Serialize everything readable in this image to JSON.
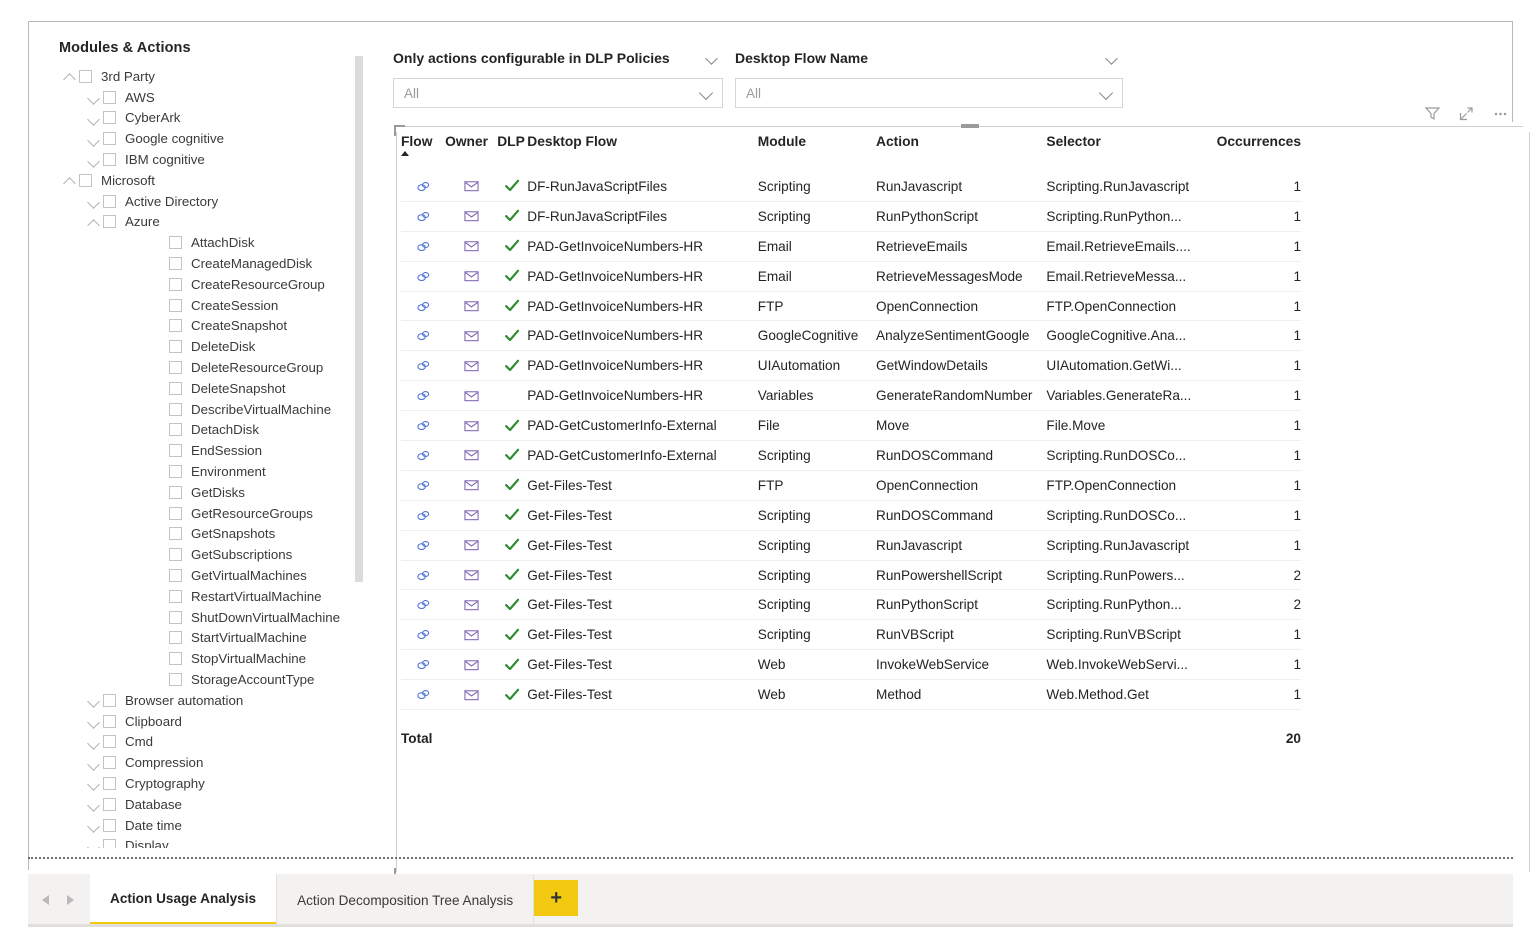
{
  "tree": {
    "title": "Modules & Actions",
    "items": [
      {
        "label": "3rd Party",
        "level": 0,
        "chevron": "up"
      },
      {
        "label": "AWS",
        "level": 1,
        "chevron": "down"
      },
      {
        "label": "CyberArk",
        "level": 1,
        "chevron": "down"
      },
      {
        "label": "Google cognitive",
        "level": 1,
        "chevron": "down"
      },
      {
        "label": "IBM cognitive",
        "level": 1,
        "chevron": "down"
      },
      {
        "label": "Microsoft",
        "level": 0,
        "chevron": "up"
      },
      {
        "label": "Active Directory",
        "level": 1,
        "chevron": "down"
      },
      {
        "label": "Azure",
        "level": 1,
        "chevron": "up"
      },
      {
        "label": "AttachDisk",
        "level": 3,
        "chevron": "none"
      },
      {
        "label": "CreateManagedDisk",
        "level": 3,
        "chevron": "none"
      },
      {
        "label": "CreateResourceGroup",
        "level": 3,
        "chevron": "none"
      },
      {
        "label": "CreateSession",
        "level": 3,
        "chevron": "none"
      },
      {
        "label": "CreateSnapshot",
        "level": 3,
        "chevron": "none"
      },
      {
        "label": "DeleteDisk",
        "level": 3,
        "chevron": "none"
      },
      {
        "label": "DeleteResourceGroup",
        "level": 3,
        "chevron": "none"
      },
      {
        "label": "DeleteSnapshot",
        "level": 3,
        "chevron": "none"
      },
      {
        "label": "DescribeVirtualMachine",
        "level": 3,
        "chevron": "none"
      },
      {
        "label": "DetachDisk",
        "level": 3,
        "chevron": "none"
      },
      {
        "label": "EndSession",
        "level": 3,
        "chevron": "none"
      },
      {
        "label": "Environment",
        "level": 3,
        "chevron": "none"
      },
      {
        "label": "GetDisks",
        "level": 3,
        "chevron": "none"
      },
      {
        "label": "GetResourceGroups",
        "level": 3,
        "chevron": "none"
      },
      {
        "label": "GetSnapshots",
        "level": 3,
        "chevron": "none"
      },
      {
        "label": "GetSubscriptions",
        "level": 3,
        "chevron": "none"
      },
      {
        "label": "GetVirtualMachines",
        "level": 3,
        "chevron": "none"
      },
      {
        "label": "RestartVirtualMachine",
        "level": 3,
        "chevron": "none"
      },
      {
        "label": "ShutDownVirtualMachine",
        "level": 3,
        "chevron": "none"
      },
      {
        "label": "StartVirtualMachine",
        "level": 3,
        "chevron": "none"
      },
      {
        "label": "StopVirtualMachine",
        "level": 3,
        "chevron": "none"
      },
      {
        "label": "StorageAccountType",
        "level": 3,
        "chevron": "none"
      },
      {
        "label": "Browser automation",
        "level": 1,
        "chevron": "down"
      },
      {
        "label": "Clipboard",
        "level": 1,
        "chevron": "down"
      },
      {
        "label": "Cmd",
        "level": 1,
        "chevron": "down"
      },
      {
        "label": "Compression",
        "level": 1,
        "chevron": "down"
      },
      {
        "label": "Cryptography",
        "level": 1,
        "chevron": "down"
      },
      {
        "label": "Database",
        "level": 1,
        "chevron": "down"
      },
      {
        "label": "Date time",
        "level": 1,
        "chevron": "down"
      },
      {
        "label": "Display",
        "level": 1,
        "chevron": "down"
      }
    ]
  },
  "slicers": [
    {
      "title": "Only actions configurable in DLP Policies",
      "value": "All"
    },
    {
      "title": "Desktop Flow Name",
      "value": "All"
    }
  ],
  "toolbar": {
    "filter_label": "Filter",
    "focus_label": "Focus mode",
    "more_label": "More options"
  },
  "table": {
    "columns": [
      "Flow",
      "Owner",
      "DLP",
      "Desktop Flow",
      "Module",
      "Action",
      "Selector",
      "Occurrences"
    ],
    "sorted_column": "Flow",
    "sort_direction": "asc",
    "rows": [
      {
        "flow": "link-icon",
        "owner": "envelope-icon",
        "dlp": true,
        "desktop_flow": "DF-RunJavaScriptFiles",
        "module": "Scripting",
        "action": "RunJavascript",
        "selector": "Scripting.RunJavascript",
        "occurrences": "1"
      },
      {
        "flow": "link-icon",
        "owner": "envelope-icon",
        "dlp": true,
        "desktop_flow": "DF-RunJavaScriptFiles",
        "module": "Scripting",
        "action": "RunPythonScript",
        "selector": "Scripting.RunPython...",
        "occurrences": "1"
      },
      {
        "flow": "link-icon",
        "owner": "envelope-icon",
        "dlp": true,
        "desktop_flow": "PAD-GetInvoiceNumbers-HR",
        "module": "Email",
        "action": "RetrieveEmails",
        "selector": "Email.RetrieveEmails....",
        "occurrences": "1"
      },
      {
        "flow": "link-icon",
        "owner": "envelope-icon",
        "dlp": true,
        "desktop_flow": "PAD-GetInvoiceNumbers-HR",
        "module": "Email",
        "action": "RetrieveMessagesMode",
        "selector": "Email.RetrieveMessa...",
        "occurrences": "1"
      },
      {
        "flow": "link-icon",
        "owner": "envelope-icon",
        "dlp": true,
        "desktop_flow": "PAD-GetInvoiceNumbers-HR",
        "module": "FTP",
        "action": "OpenConnection",
        "selector": "FTP.OpenConnection",
        "occurrences": "1"
      },
      {
        "flow": "link-icon",
        "owner": "envelope-icon",
        "dlp": true,
        "desktop_flow": "PAD-GetInvoiceNumbers-HR",
        "module": "GoogleCognitive",
        "action": "AnalyzeSentimentGoogle",
        "selector": "GoogleCognitive.Ana...",
        "occurrences": "1"
      },
      {
        "flow": "link-icon",
        "owner": "envelope-icon",
        "dlp": true,
        "desktop_flow": "PAD-GetInvoiceNumbers-HR",
        "module": "UIAutomation",
        "action": "GetWindowDetails",
        "selector": "UIAutomation.GetWi...",
        "occurrences": "1"
      },
      {
        "flow": "link-icon",
        "owner": "envelope-icon",
        "dlp": false,
        "desktop_flow": "PAD-GetInvoiceNumbers-HR",
        "module": "Variables",
        "action": "GenerateRandomNumber",
        "selector": "Variables.GenerateRa...",
        "occurrences": "1"
      },
      {
        "flow": "link-icon",
        "owner": "envelope-icon",
        "dlp": true,
        "desktop_flow": "PAD-GetCustomerInfo-External",
        "module": "File",
        "action": "Move",
        "selector": "File.Move",
        "occurrences": "1"
      },
      {
        "flow": "link-icon",
        "owner": "envelope-icon",
        "dlp": true,
        "desktop_flow": "PAD-GetCustomerInfo-External",
        "module": "Scripting",
        "action": "RunDOSCommand",
        "selector": "Scripting.RunDOSCo...",
        "occurrences": "1"
      },
      {
        "flow": "link-icon",
        "owner": "envelope-icon",
        "dlp": true,
        "desktop_flow": "Get-Files-Test",
        "module": "FTP",
        "action": "OpenConnection",
        "selector": "FTP.OpenConnection",
        "occurrences": "1"
      },
      {
        "flow": "link-icon",
        "owner": "envelope-icon",
        "dlp": true,
        "desktop_flow": "Get-Files-Test",
        "module": "Scripting",
        "action": "RunDOSCommand",
        "selector": "Scripting.RunDOSCo...",
        "occurrences": "1"
      },
      {
        "flow": "link-icon",
        "owner": "envelope-icon",
        "dlp": true,
        "desktop_flow": "Get-Files-Test",
        "module": "Scripting",
        "action": "RunJavascript",
        "selector": "Scripting.RunJavascript",
        "occurrences": "1"
      },
      {
        "flow": "link-icon",
        "owner": "envelope-icon",
        "dlp": true,
        "desktop_flow": "Get-Files-Test",
        "module": "Scripting",
        "action": "RunPowershellScript",
        "selector": "Scripting.RunPowers...",
        "occurrences": "2"
      },
      {
        "flow": "link-icon",
        "owner": "envelope-icon",
        "dlp": true,
        "desktop_flow": "Get-Files-Test",
        "module": "Scripting",
        "action": "RunPythonScript",
        "selector": "Scripting.RunPython...",
        "occurrences": "2"
      },
      {
        "flow": "link-icon",
        "owner": "envelope-icon",
        "dlp": true,
        "desktop_flow": "Get-Files-Test",
        "module": "Scripting",
        "action": "RunVBScript",
        "selector": "Scripting.RunVBScript",
        "occurrences": "1"
      },
      {
        "flow": "link-icon",
        "owner": "envelope-icon",
        "dlp": true,
        "desktop_flow": "Get-Files-Test",
        "module": "Web",
        "action": "InvokeWebService",
        "selector": "Web.InvokeWebServi...",
        "occurrences": "1"
      },
      {
        "flow": "link-icon",
        "owner": "envelope-icon",
        "dlp": true,
        "desktop_flow": "Get-Files-Test",
        "module": "Web",
        "action": "Method",
        "selector": "Web.Method.Get",
        "occurrences": "1"
      }
    ],
    "total_label": "Total",
    "total_value": "20"
  },
  "tabs": {
    "items": [
      {
        "label": "Action Usage Analysis",
        "active": true
      },
      {
        "label": "Action Decomposition Tree Analysis",
        "active": false
      }
    ],
    "add_label": "+"
  },
  "colors": {
    "accent_yellow": "#F2C811",
    "flow_icon": "#4A6FD4",
    "owner_icon": "#7B62B3",
    "dlp_check": "#2E8B2E"
  }
}
